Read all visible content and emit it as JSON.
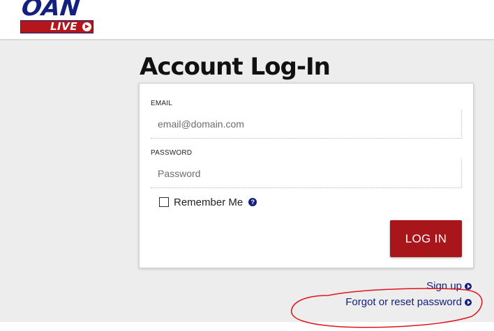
{
  "header": {
    "logo": {
      "wordmark": "OAN",
      "badge": "LIVE",
      "brand_blue": "#13207d",
      "brand_red": "#b5161c"
    }
  },
  "page": {
    "title": "Account Log-In"
  },
  "form": {
    "email": {
      "label": "EMAIL",
      "placeholder": "email@domain.com",
      "value": ""
    },
    "password": {
      "label": "PASSWORD",
      "placeholder": "Password",
      "value": ""
    },
    "remember": {
      "label": "Remember Me",
      "checked": false,
      "help_icon": "question-circle-icon"
    },
    "submit_label": "LOG IN",
    "submit_color": "#a8151a"
  },
  "links": {
    "signup": {
      "label": "Sign up",
      "icon": "arrow-circle-right-icon"
    },
    "forgot": {
      "label": "Forgot or reset password",
      "icon": "arrow-circle-right-icon"
    }
  },
  "annotation": {
    "shape": "hand-drawn ellipse around forgot password link",
    "color": "#e0121b"
  }
}
